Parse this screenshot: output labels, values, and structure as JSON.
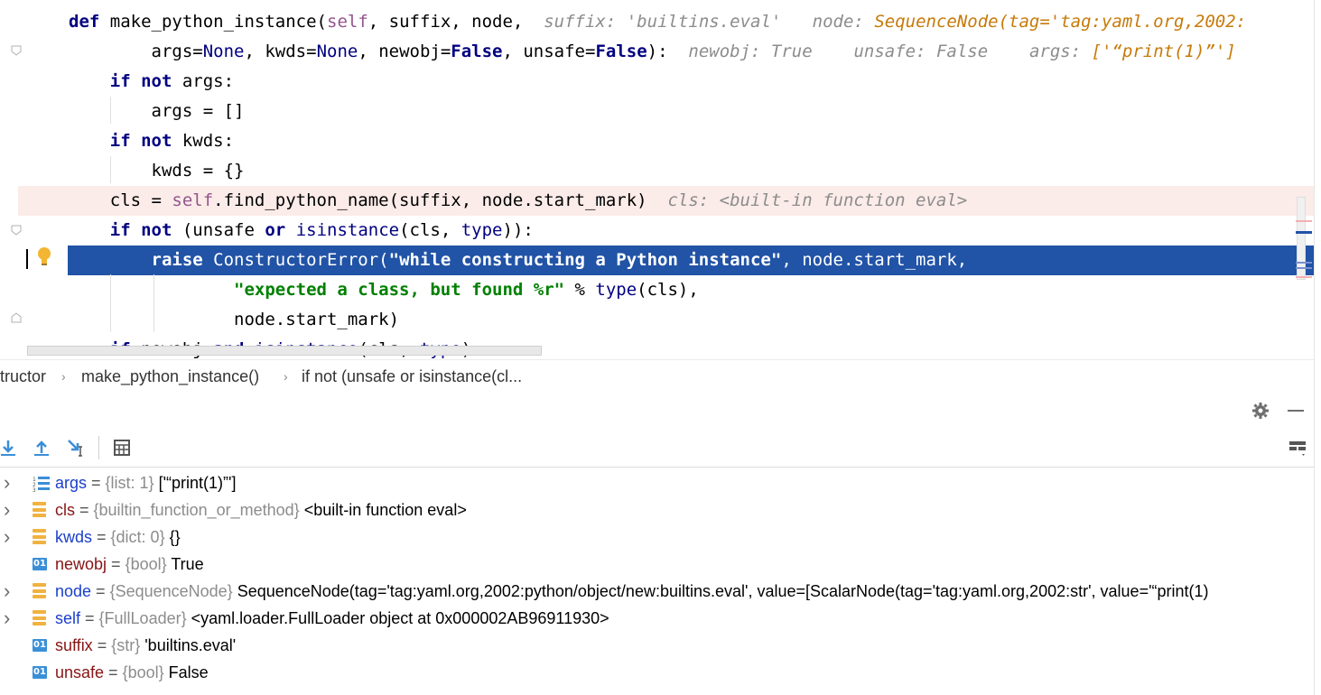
{
  "editor": {
    "lines": [
      {
        "tokens": [
          [
            "kw",
            "def"
          ],
          [
            "plain",
            " make_python_instance("
          ],
          [
            "sf",
            "self"
          ],
          [
            "plain",
            ", suffix, node,  "
          ],
          [
            "hint",
            "suffix: 'builtins.eval'"
          ],
          [
            "plain",
            "   "
          ],
          [
            "hint",
            "node: "
          ],
          [
            "hint-orange",
            "SequenceNode(tag='tag:yaml.org,2002:"
          ]
        ]
      },
      {
        "tokens": [
          [
            "plain",
            "        args="
          ],
          [
            "bi",
            "None"
          ],
          [
            "plain",
            ", kwds="
          ],
          [
            "bi",
            "None"
          ],
          [
            "plain",
            ", newobj="
          ],
          [
            "kw",
            "False"
          ],
          [
            "plain",
            ", unsafe="
          ],
          [
            "kw",
            "False"
          ],
          [
            "plain",
            "):  "
          ],
          [
            "hint",
            "newobj: True"
          ],
          [
            "plain",
            "    "
          ],
          [
            "hint",
            "unsafe: False"
          ],
          [
            "plain",
            "    "
          ],
          [
            "hint",
            "args: "
          ],
          [
            "hint-orange",
            "['“print(1)”']"
          ]
        ]
      },
      {
        "tokens": [
          [
            "plain",
            "    "
          ],
          [
            "kw",
            "if not"
          ],
          [
            "plain",
            " args:"
          ]
        ]
      },
      {
        "tokens": [
          [
            "plain",
            "        args = []"
          ]
        ]
      },
      {
        "tokens": [
          [
            "plain",
            "    "
          ],
          [
            "kw",
            "if not"
          ],
          [
            "plain",
            " kwds:"
          ]
        ]
      },
      {
        "tokens": [
          [
            "plain",
            "        kwds = {}"
          ]
        ]
      },
      {
        "tokens": [
          [
            "plain",
            "    cls = "
          ],
          [
            "sf",
            "self"
          ],
          [
            "plain",
            ".find_python_name(suffix, node.start_mark)  "
          ],
          [
            "hint",
            "cls: <built-in function eval>"
          ]
        ]
      },
      {
        "tokens": [
          [
            "plain",
            "    "
          ],
          [
            "kw",
            "if not"
          ],
          [
            "plain",
            " (unsafe "
          ],
          [
            "kw",
            "or"
          ],
          [
            "plain",
            " "
          ],
          [
            "bi",
            "isinstance"
          ],
          [
            "plain",
            "(cls, "
          ],
          [
            "bi",
            "type"
          ],
          [
            "plain",
            ")):"
          ]
        ]
      },
      {
        "tokens": [
          [
            "plain",
            "        "
          ],
          [
            "kw",
            "raise"
          ],
          [
            "plain",
            " ConstructorError("
          ],
          [
            "str",
            "\"while constructing a Python instance\""
          ],
          [
            "plain",
            ", node.start_mark,"
          ]
        ]
      },
      {
        "tokens": [
          [
            "plain",
            "                "
          ],
          [
            "str",
            "\"expected a class, but found %r\""
          ],
          [
            "plain",
            " % "
          ],
          [
            "bi",
            "type"
          ],
          [
            "plain",
            "(cls),"
          ]
        ]
      },
      {
        "tokens": [
          [
            "plain",
            "                node.start_mark)"
          ]
        ]
      },
      {
        "tokens": [
          [
            "plain",
            "    "
          ],
          [
            "kw",
            "if"
          ],
          [
            "plain",
            " newobj "
          ],
          [
            "kw",
            "and"
          ],
          [
            "plain",
            " "
          ],
          [
            "bi",
            "isinstance"
          ],
          [
            "plain",
            "(cls, "
          ],
          [
            "bi",
            "type"
          ],
          [
            "plain",
            "):"
          ]
        ]
      }
    ]
  },
  "breadcrumb": {
    "items": [
      "tructor",
      "make_python_instance()",
      "if not (unsafe or isinstance(cl..."
    ]
  },
  "panel": {
    "settings_icon": "gear-icon",
    "minimize_icon": "minus-icon"
  },
  "variables": [
    {
      "expandable": true,
      "icon": "list",
      "name": "args",
      "name_color": "blue",
      "type": "{list: 1}",
      "value": "['“print(1)”']"
    },
    {
      "expandable": true,
      "icon": "field",
      "name": "cls",
      "name_color": "red",
      "type": "{builtin_function_or_method}",
      "value": "<built-in function eval>"
    },
    {
      "expandable": true,
      "icon": "field",
      "name": "kwds",
      "name_color": "blue",
      "type": "{dict: 0}",
      "value": "{}"
    },
    {
      "expandable": false,
      "icon": "primitive",
      "name": "newobj",
      "name_color": "red",
      "type": "{bool}",
      "value": "True"
    },
    {
      "expandable": true,
      "icon": "field",
      "name": "node",
      "name_color": "blue",
      "type": "{SequenceNode}",
      "value": "SequenceNode(tag='tag:yaml.org,2002:python/object/new:builtins.eval', value=[ScalarNode(tag='tag:yaml.org,2002:str', value='“print(1)"
    },
    {
      "expandable": true,
      "icon": "field",
      "name": "self",
      "name_color": "blue",
      "type": "{FullLoader}",
      "value": "<yaml.loader.FullLoader object at 0x000002AB96911930>"
    },
    {
      "expandable": false,
      "icon": "primitive",
      "name": "suffix",
      "name_color": "red",
      "type": "{str}",
      "value": "'builtins.eval'"
    },
    {
      "expandable": false,
      "icon": "primitive",
      "name": "unsafe",
      "name_color": "red",
      "type": "{bool}",
      "value": "False"
    }
  ],
  "colors": {
    "selection": "#2153a6",
    "error_line": "#fbece9",
    "keyword": "#000080",
    "string": "#008000",
    "self": "#94558d"
  }
}
